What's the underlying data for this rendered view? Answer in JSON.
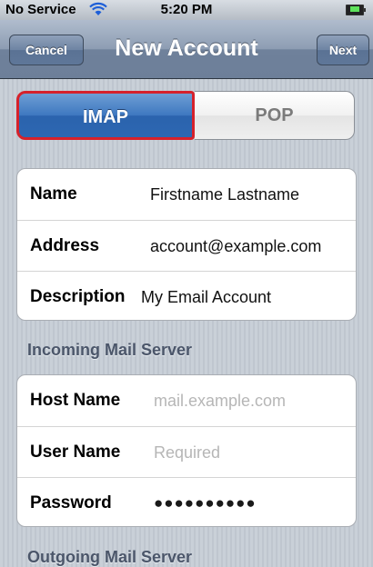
{
  "status_bar": {
    "carrier": "No Service",
    "wifi_icon": "wifi-icon",
    "time": "5:20 PM",
    "battery_icon": "battery-charging-icon"
  },
  "nav": {
    "title": "New Account",
    "cancel_label": "Cancel",
    "next_label": "Next"
  },
  "account_type": {
    "options": [
      "IMAP",
      "POP"
    ],
    "selected": "IMAP",
    "highlight_color": "#d6212b"
  },
  "account_fields": [
    {
      "label": "Name",
      "value": "Firstname Lastname"
    },
    {
      "label": "Address",
      "value": "account@example.com"
    },
    {
      "label": "Description",
      "value": "My Email Account"
    }
  ],
  "incoming": {
    "header": "Incoming Mail Server",
    "fields": [
      {
        "label": "Host Name",
        "placeholder": "mail.example.com"
      },
      {
        "label": "User Name",
        "placeholder": "Required"
      },
      {
        "label": "Password",
        "value": "●●●●●●●●●●"
      }
    ]
  },
  "outgoing": {
    "header": "Outgoing Mail Server"
  },
  "colors": {
    "selected_segment": "#3e78c0",
    "nav_bar": "#6f819b",
    "background": "#c5ccd4"
  }
}
